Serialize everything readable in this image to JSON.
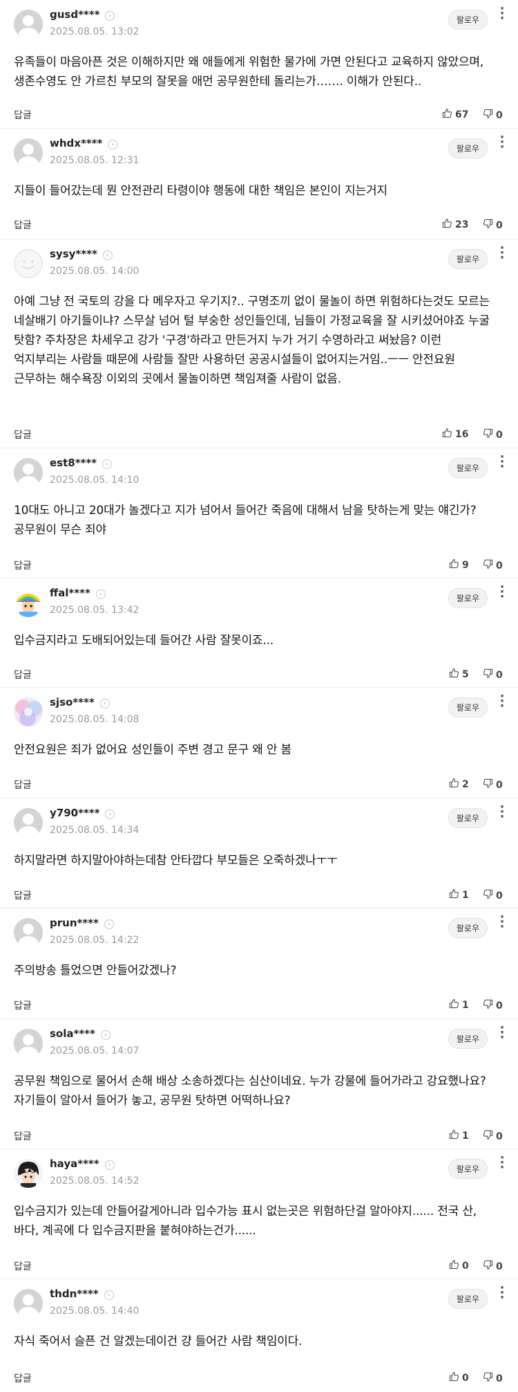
{
  "labels": {
    "follow": "팔로우",
    "reply": "답글"
  },
  "comments": [
    {
      "user": "gusd****",
      "date": "2025.08.05. 13:02",
      "text": "유족들이 마음아픈 것은 이해하지만 왜 애들에게 위험한 물가에 가면 안된다고 교육하지 않았으며, 생존수영도 안 가르친 부모의 잘못을 애먼 공무원한테 돌리는가……. 이해가 안된다..",
      "likes": "67",
      "dislikes": "0",
      "avatar": "default"
    },
    {
      "user": "whdx****",
      "date": "2025.08.05. 12:31",
      "text": "지들이 들어갔는데 뭔 안전관리 타령이야 행동에 대한 책임은 본인이 지는거지",
      "likes": "23",
      "dislikes": "0",
      "avatar": "default"
    },
    {
      "user": "sysy****",
      "date": "2025.08.05. 14:00",
      "text": "아예 그냥 전 국토의 강을 다 메우자고 우기지?.. 구명조끼 없이 물놀이 하면 위험하다는것도 모르는 네살배기 아기들이냐? 스무살 넘어 털 부숭한 성인들인데, 님들이 가정교육을 잘 시키셨어야죠 누굴 탓함? 주차장은 차세우고 강가 '구경'하라고 만든거지 누가 거기 수영하라고 써놨음? 이런 억지부리는 사람들 때문에 사람들 잘만 사용하던 공공시설들이 없어지는거임..ㅡㅡ 안전요원 근무하는 해수욕장 이외의 곳에서 물놀이하면 책임져줄 사람이 없음.",
      "likes": "16",
      "dislikes": "0",
      "avatar": "smile"
    },
    {
      "user": "est8****",
      "date": "2025.08.05. 14:10",
      "text": "10대도 아니고 20대가 놀겠다고 지가 넘어서 들어간 죽음에 대해서 남을 탓하는게 맞는 얘긴가? 공무원이 무슨 죄야",
      "likes": "9",
      "dislikes": "0",
      "avatar": "default"
    },
    {
      "user": "ffal****",
      "date": "2025.08.05. 13:42",
      "text": "입수금지라고 도배되어있는데 들어간 사람 잘못이죠...",
      "likes": "5",
      "dislikes": "0",
      "avatar": "colorful"
    },
    {
      "user": "sjso****",
      "date": "2025.08.05. 14:08",
      "text": "안전요원은 죄가 없어요 성인들이 주변 경고 문구 왜 안 봄",
      "likes": "2",
      "dislikes": "0",
      "avatar": "pastel"
    },
    {
      "user": "y790****",
      "date": "2025.08.05. 14:34",
      "text": "하지말라면 하지말아야하는데참 안타깝다 부모들은 오죽하겠나ㅜㅜ",
      "likes": "1",
      "dislikes": "0",
      "avatar": "default"
    },
    {
      "user": "prun****",
      "date": "2025.08.05. 14:22",
      "text": "주의방송 틀었으면 안들어갔겠나?",
      "likes": "1",
      "dislikes": "0",
      "avatar": "default"
    },
    {
      "user": "sola****",
      "date": "2025.08.05. 14:07",
      "text": "공무원 책임으로 물어서 손해 배상 소송하겠다는 심산이네요. 누가 강물에 들어가라고 강요했나요? 자기들이 알아서 들어가 놓고, 공무원 탓하면 어떡하나요?",
      "likes": "1",
      "dislikes": "0",
      "avatar": "default"
    },
    {
      "user": "haya****",
      "date": "2025.08.05. 14:52",
      "text": "입수금지가 있는데 안들어갈게아니라 입수가능 표시 없는곳은 위험하단걸 알아야지...... 전국 산, 바다, 계곡에 다 입수금지판을 붙혀야하는건가......",
      "likes": "0",
      "dislikes": "0",
      "avatar": "anime"
    },
    {
      "user": "thdn****",
      "date": "2025.08.05. 14:40",
      "text": "자식 죽어서 슬픈 건 알겠는데이건 걍 들어간 사람 책임이다.",
      "likes": "0",
      "dislikes": "0",
      "avatar": "default"
    }
  ]
}
